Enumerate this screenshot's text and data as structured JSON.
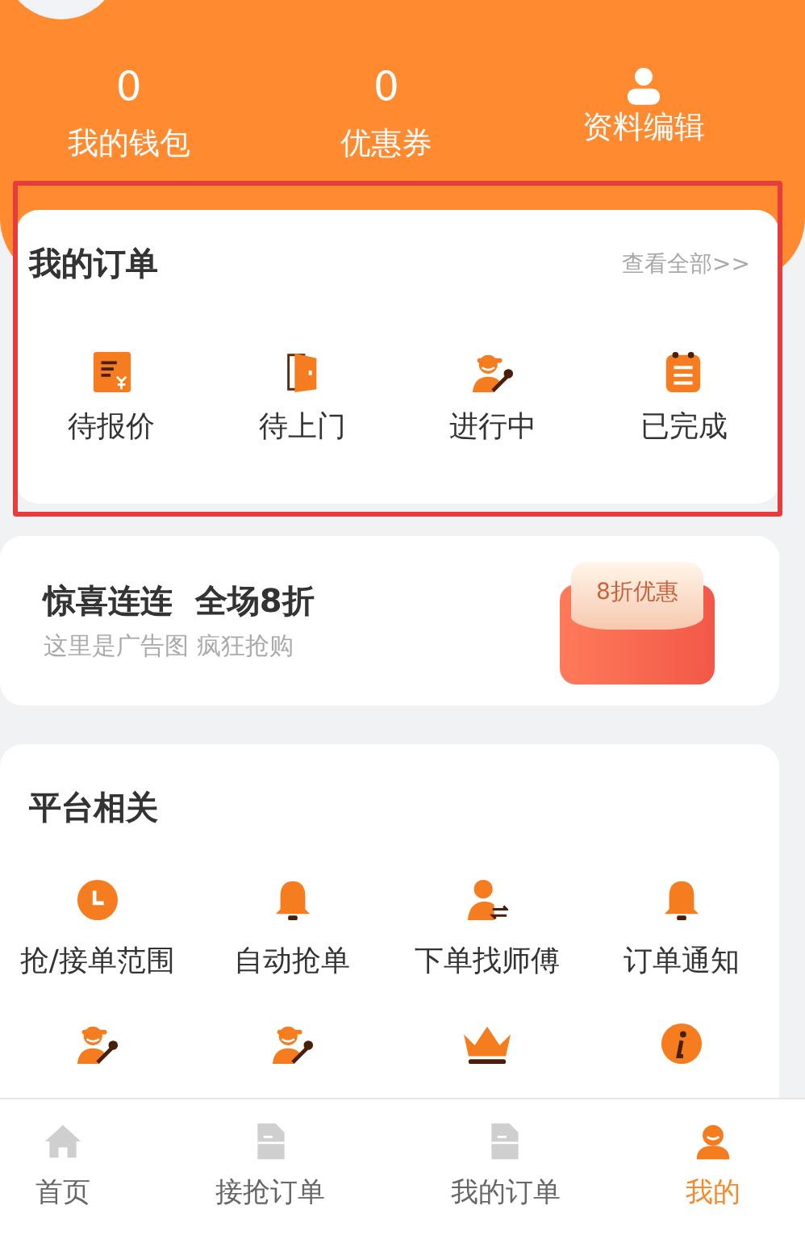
{
  "stats": [
    {
      "value": "0",
      "label": "我的钱包"
    },
    {
      "value": "0",
      "label": "优惠券"
    }
  ],
  "profile_edit": {
    "label": "资料编辑"
  },
  "orders": {
    "title": "我的订单",
    "view_all": "查看全部>>",
    "items": [
      "待报价",
      "待上门",
      "进行中",
      "已完成"
    ]
  },
  "banner": {
    "title": "惊喜连连  全场8折",
    "subtitle": "这里是广告图 疯狂抢购",
    "badge": "8折优惠"
  },
  "platform": {
    "title": "平台相关",
    "items": [
      {
        "kind": "labelled",
        "label": "抢/接单范围"
      },
      {
        "kind": "labelled",
        "label": "自动抢单"
      },
      {
        "kind": "labelled",
        "label": "下单找师傅"
      },
      {
        "kind": "labelled",
        "label": "订单通知"
      },
      {
        "kind": "icon_only"
      },
      {
        "kind": "icon_only"
      },
      {
        "kind": "icon_only"
      },
      {
        "kind": "icon_only"
      }
    ]
  },
  "tab_bar": [
    {
      "label": "首页",
      "selected": false
    },
    {
      "label": "接抢订单",
      "selected": false
    },
    {
      "label": "我的订单",
      "selected": false
    },
    {
      "label": "我的",
      "selected": true
    }
  ]
}
